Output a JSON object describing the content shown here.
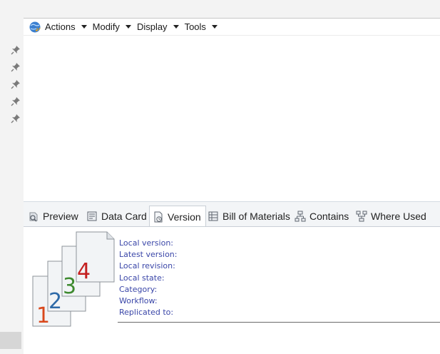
{
  "toolbar": {
    "icon": "refresh-globe-icon",
    "menus": [
      {
        "label": "Actions"
      },
      {
        "label": "Modify"
      },
      {
        "label": "Display"
      },
      {
        "label": "Tools"
      }
    ]
  },
  "gutter": {
    "pins": [
      "pin-icon",
      "pin-icon",
      "pin-icon",
      "pin-icon",
      "pin-icon"
    ]
  },
  "tabs": [
    {
      "label": "Preview",
      "icon": "preview-icon",
      "active": false
    },
    {
      "label": "Data Card",
      "icon": "data-card-icon",
      "active": false
    },
    {
      "label": "Version",
      "icon": "version-icon",
      "active": true
    },
    {
      "label": "Bill of Materials",
      "icon": "bill-of-materials-icon",
      "active": false
    },
    {
      "label": "Contains",
      "icon": "contains-icon",
      "active": false
    },
    {
      "label": "Where Used",
      "icon": "where-used-icon",
      "active": false
    }
  ],
  "version": {
    "art_digits": [
      "1",
      "2",
      "3",
      "4"
    ],
    "art_colors": [
      "#d9481c",
      "#2e6aa8",
      "#3e8a2f",
      "#c42020"
    ],
    "fields": [
      {
        "label": "Local version:"
      },
      {
        "label": "Latest version:"
      },
      {
        "label": "Local revision:"
      },
      {
        "label": "Local state:"
      },
      {
        "label": "Category:"
      },
      {
        "label": "Workflow:"
      },
      {
        "label": "Replicated to:"
      }
    ]
  },
  "colors": {
    "field_label": "#3a46a8",
    "panel_bg": "#f3f5f7",
    "active_tab_bg": "#ffffff"
  }
}
